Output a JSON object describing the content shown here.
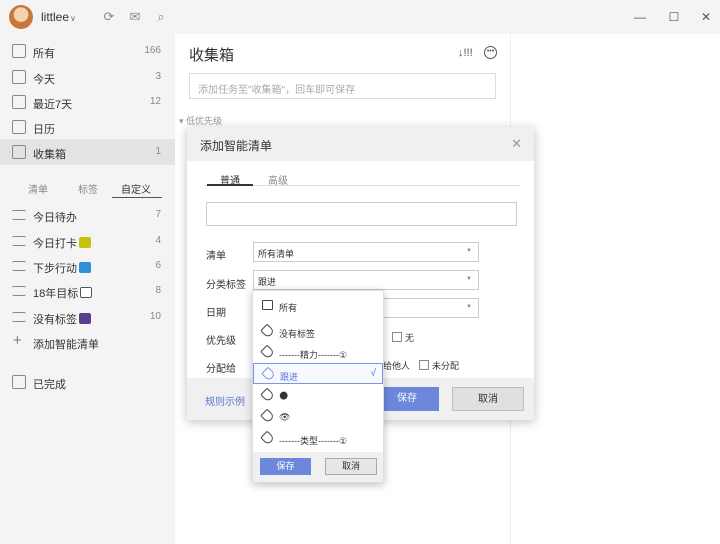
{
  "titlebar": {
    "username": "littlee",
    "icons": [
      "sync-icon",
      "mail-icon",
      "search-icon"
    ],
    "window": [
      "minimize-icon",
      "maximize-icon",
      "close-icon"
    ]
  },
  "sidebar": {
    "items": [
      {
        "label": "所有",
        "count": "166",
        "icon": "all-icon"
      },
      {
        "label": "今天",
        "count": "3",
        "icon": "calendar-today-icon"
      },
      {
        "label": "最近7天",
        "count": "12",
        "icon": "calendar-week-icon"
      },
      {
        "label": "日历",
        "count": "",
        "icon": "calendar-icon"
      },
      {
        "label": "收集箱",
        "count": "1",
        "icon": "inbox-icon"
      }
    ],
    "tabs": [
      "清单",
      "标签",
      "自定义"
    ],
    "smart_lists": [
      {
        "label": "今日待办",
        "count": "7"
      },
      {
        "label": "今日打卡",
        "count": "4"
      },
      {
        "label": "下步行动",
        "count": "6"
      },
      {
        "label": "18年目标",
        "count": "8"
      },
      {
        "label": "没有标签",
        "count": "10"
      }
    ],
    "add_smart_list": "添加智能清单",
    "completed": "已完成"
  },
  "main": {
    "title": "收集箱",
    "sort_label": "↓!!!",
    "add_placeholder": "添加任务至\"收集箱\"，回车即可保存",
    "group_label": "低优先级"
  },
  "dialog": {
    "title": "添加智能清单",
    "tabs": [
      "普通",
      "高级"
    ],
    "rows": {
      "list_label": "清单",
      "list_value": "所有清单",
      "tag_label": "分类标签",
      "tag_value": "跟进",
      "date_label": "日期",
      "priority_label": "优先级",
      "priority_none": "无",
      "assign_label": "分配给",
      "assign_other": "给他人",
      "assign_unassigned": "未分配"
    },
    "rules_link": "规则示例",
    "save": "保存",
    "cancel": "取消"
  },
  "dropdown": {
    "items": [
      "所有",
      "没有标签",
      "-------精力-------①",
      "跟进",
      "🌑",
      "👁",
      "-------类型-------①"
    ],
    "selected_index": 3,
    "check": "√",
    "save": "保存",
    "cancel": "取消"
  }
}
